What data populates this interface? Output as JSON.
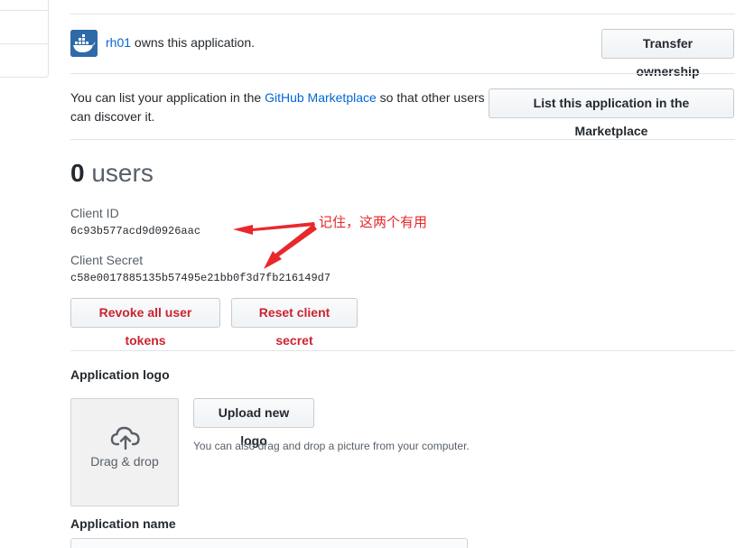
{
  "owner": {
    "username": "rh01",
    "suffix": " owns this application.",
    "transfer_button": "Transfer ownership"
  },
  "marketplace": {
    "text_before": "You can list your application in the ",
    "link": "GitHub Marketplace",
    "text_after": " so that other users can discover it.",
    "button": "List this application in the Marketplace"
  },
  "users": {
    "count": "0",
    "label": "users"
  },
  "credentials": {
    "client_id_label": "Client ID",
    "client_id": "6c93b577acd9d0926aac",
    "client_secret_label": "Client Secret",
    "client_secret": "c58e0017885135b57495e21bb0f3d7fb216149d7"
  },
  "annotation": {
    "text": "记住，这两个有用",
    "color": "#e8282b"
  },
  "actions": {
    "revoke": "Revoke all user tokens",
    "reset": "Reset client secret"
  },
  "logo": {
    "title": "Application logo",
    "dropzone_label": "Drag & drop",
    "upload_button": "Upload new logo",
    "note": "You can also drag and drop a picture from your computer."
  },
  "app_name": {
    "title": "Application name"
  },
  "colors": {
    "link": "#0366d6",
    "danger": "#cb2431"
  }
}
